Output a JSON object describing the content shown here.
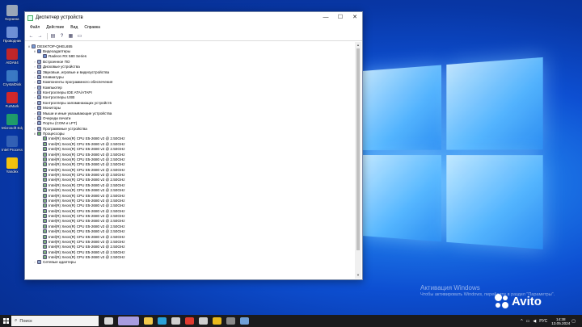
{
  "desktop": {
    "icons": [
      {
        "label": "Корзина",
        "color": "#9aa6b8"
      },
      {
        "label": "Проводник",
        "color": "#6d8fd6"
      },
      {
        "label": "AIDA64",
        "color": "#c0262a"
      },
      {
        "label": "CrystalDisk",
        "color": "#3a79c4"
      },
      {
        "label": "FurMark",
        "color": "#d2282b"
      },
      {
        "label": "Microsoft Edge",
        "color": "#1f9c6a"
      },
      {
        "label": "Intel Processor Diagnostic",
        "color": "#3260b5"
      },
      {
        "label": "Yandex",
        "color": "#f4c20d"
      }
    ]
  },
  "window": {
    "title": "Диспетчер устройств",
    "controls": {
      "minimize": "—",
      "maximize": "☐",
      "close": "✕"
    },
    "menu": [
      "Файл",
      "Действие",
      "Вид",
      "Справка"
    ],
    "toolbar_icons": [
      "back-icon",
      "forward-icon",
      "properties-icon",
      "help-icon",
      "view-icon",
      "monitor-icon"
    ],
    "tree": {
      "root": "DESKTOP-QHEL655",
      "display_adapters": {
        "label": "Видеоадаптеры",
        "child": "Radeon RX 580 Series"
      },
      "categories": [
        "Встроенное ПО",
        "Дисковые устройства",
        "Звуковые, игровые и видеоустройства",
        "Клавиатуры",
        "Компоненты программного обеспечения",
        "Компьютер",
        "Контроллеры IDE ATA/ATAPI",
        "Контроллеры USB",
        "Контроллеры запоминающих устройств",
        "Мониторы",
        "Мыши и иные указывающие устройства",
        "Очереди печати",
        "Порты (COM и LPT)",
        "Программные устройства"
      ],
      "processors": {
        "label": "Процессоры",
        "items": [
          "Intel(R) Xeon(R) CPU E5-2680 v3 @ 2.50GHz",
          "Intel(R) Xeon(R) CPU E5-2680 v3 @ 2.50GHz",
          "Intel(R) Xeon(R) CPU E5-2680 v3 @ 2.50GHz",
          "Intel(R) Xeon(R) CPU E5-2680 v3 @ 2.50GHz",
          "Intel(R) Xeon(R) CPU E5-2680 v3 @ 2.50GHz",
          "Intel(R) Xeon(R) CPU E5-2680 v3 @ 2.50GHz",
          "Intel(R) Xeon(R) CPU E5-2680 v3 @ 2.50GHz",
          "Intel(R) Xeon(R) CPU E5-2680 v3 @ 2.50GHz",
          "Intel(R) Xeon(R) CPU E5-2680 v3 @ 2.50GHz",
          "Intel(R) Xeon(R) CPU E5-2680 v3 @ 2.50GHz",
          "Intel(R) Xeon(R) CPU E5-2680 v3 @ 2.50GHz",
          "Intel(R) Xeon(R) CPU E5-2680 v3 @ 2.50GHz",
          "Intel(R) Xeon(R) CPU E5-2680 v3 @ 2.50GHz",
          "Intel(R) Xeon(R) CPU E5-2680 v3 @ 2.50GHz",
          "Intel(R) Xeon(R) CPU E5-2680 v3 @ 2.50GHz",
          "Intel(R) Xeon(R) CPU E5-2680 v3 @ 2.50GHz",
          "Intel(R) Xeon(R) CPU E5-2680 v3 @ 2.50GHz",
          "Intel(R) Xeon(R) CPU E5-2680 v3 @ 2.50GHz",
          "Intel(R) Xeon(R) CPU E5-2680 v3 @ 2.50GHz",
          "Intel(R) Xeon(R) CPU E5-2680 v3 @ 2.50GHz",
          "Intel(R) Xeon(R) CPU E5-2680 v3 @ 2.50GHz",
          "Intel(R) Xeon(R) CPU E5-2680 v3 @ 2.50GHz",
          "Intel(R) Xeon(R) CPU E5-2680 v3 @ 2.50GHz",
          "Intel(R) Xeon(R) CPU E5-2680 v3 @ 2.50GHz"
        ]
      },
      "network": "Сетевые адаптеры"
    }
  },
  "watermark": {
    "line1": "Активация Windows",
    "line2": "Чтобы активировать Windows, перейдите в раздел \"Параметры\"."
  },
  "brand": {
    "text": "Avito"
  },
  "taskbar": {
    "search_placeholder": "Поиск",
    "apps": [
      {
        "icon": "task-view-icon",
        "color": "#d8d8d8"
      },
      {
        "icon": "game-thumbnail-icon",
        "color": "#a79ce0"
      },
      {
        "icon": "file-explorer-icon",
        "color": "#f2c94c"
      },
      {
        "icon": "edge-icon",
        "color": "#2aa1d8"
      },
      {
        "icon": "store-icon",
        "color": "#cfcfcf"
      },
      {
        "icon": "yandex-icon",
        "color": "#e03a2f"
      },
      {
        "icon": "mail-icon",
        "color": "#cfcfcf"
      },
      {
        "icon": "yandex-browser-icon",
        "color": "#e8b91c"
      },
      {
        "icon": "app-icon",
        "color": "#8a8a8a"
      },
      {
        "icon": "device-manager-icon",
        "color": "#6fa0d8"
      }
    ],
    "tray": {
      "lang": "РУС",
      "time": "14:38",
      "date": "13.05.2024"
    }
  }
}
